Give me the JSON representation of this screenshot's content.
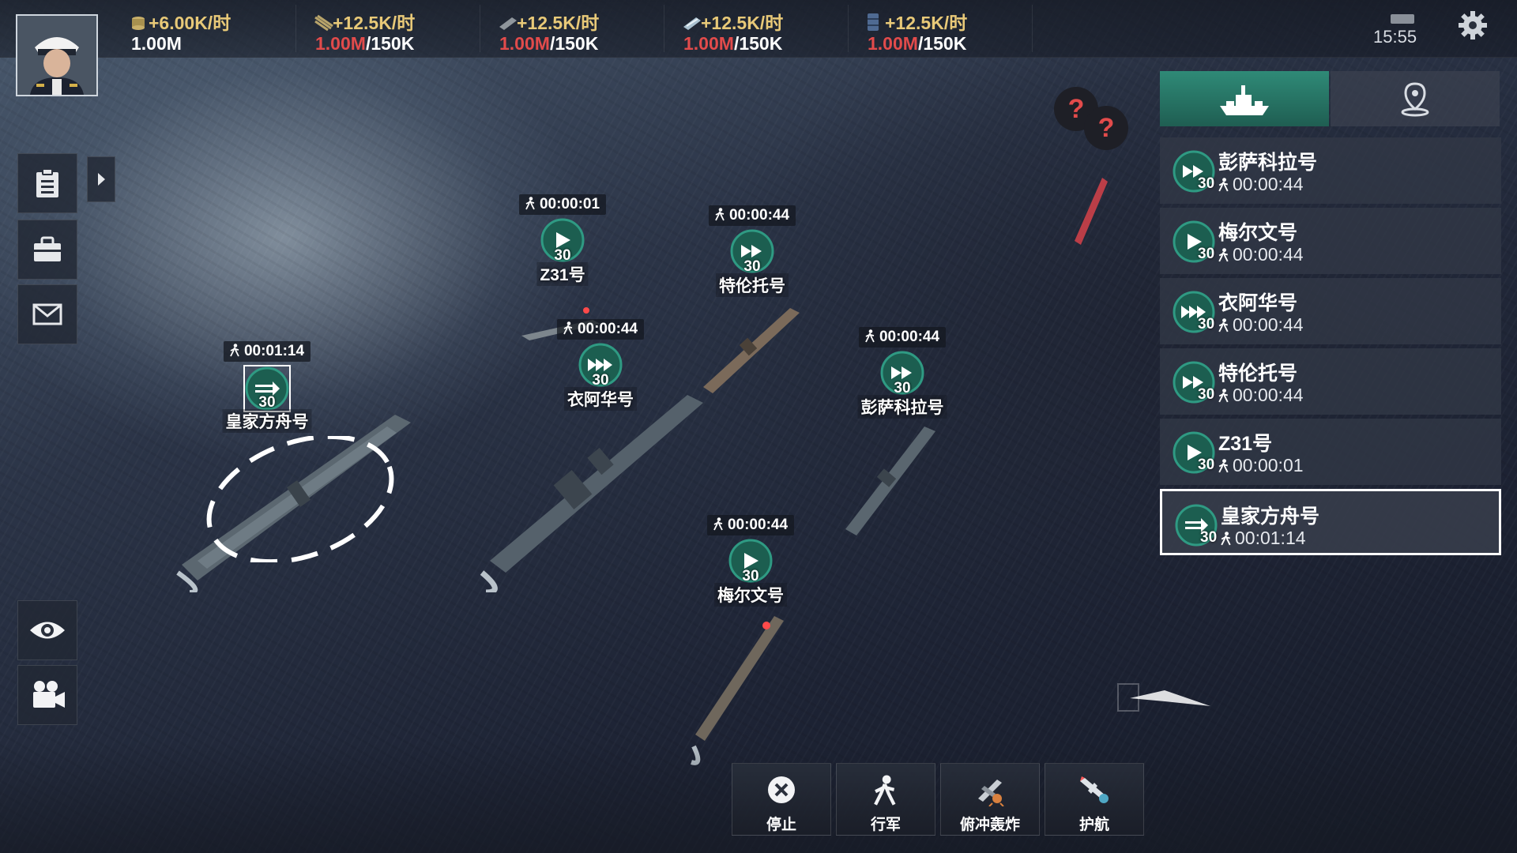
{
  "resources": [
    {
      "icon": "coin-stack-icon",
      "rate": "+6.00K/时",
      "current": "1.00M",
      "cap": ""
    },
    {
      "icon": "oil-icon",
      "rate": "+12.5K/时",
      "current": "1.00M",
      "cap": "/150K"
    },
    {
      "icon": "steel-icon",
      "rate": "+12.5K/时",
      "current": "1.00M",
      "cap": "/150K"
    },
    {
      "icon": "aluminum-icon",
      "rate": "+12.5K/时",
      "current": "1.00M",
      "cap": "/150K"
    },
    {
      "icon": "fuel-barrel-icon",
      "rate": "+12.5K/时",
      "current": "1.00M",
      "cap": "/150K"
    }
  ],
  "status": {
    "clock": "15:55"
  },
  "map_markers": [
    {
      "name": "Z31号",
      "timer": "00:00:01",
      "level": "30"
    },
    {
      "name": "特伦托号",
      "timer": "00:00:44",
      "level": "30"
    },
    {
      "name": "衣阿华号",
      "timer": "00:00:44",
      "level": "30"
    },
    {
      "name": "彭萨科拉号",
      "timer": "00:00:44",
      "level": "30"
    },
    {
      "name": "皇家方舟号",
      "timer": "00:01:14",
      "level": "30"
    },
    {
      "name": "梅尔文号",
      "timer": "00:00:44",
      "level": "30"
    }
  ],
  "fleet_list": [
    {
      "name": "彭萨科拉号",
      "time": "00:00:44",
      "level": "30",
      "selected": false
    },
    {
      "name": "梅尔文号",
      "time": "00:00:44",
      "level": "30",
      "selected": false
    },
    {
      "name": "衣阿华号",
      "time": "00:00:44",
      "level": "30",
      "selected": false
    },
    {
      "name": "特伦托号",
      "time": "00:00:44",
      "level": "30",
      "selected": false
    },
    {
      "name": "Z31号",
      "time": "00:00:01",
      "level": "30",
      "selected": false
    },
    {
      "name": "皇家方舟号",
      "time": "00:01:14",
      "level": "30",
      "selected": true
    }
  ],
  "actions": [
    {
      "label": "停止",
      "icon": "stop-x-icon"
    },
    {
      "label": "行军",
      "icon": "walk-icon"
    },
    {
      "label": "俯冲轰炸",
      "icon": "dive-bomb-icon"
    },
    {
      "label": "护航",
      "icon": "escort-plane-icon"
    }
  ],
  "unknown_markers": [
    "?",
    "?"
  ],
  "colors": {
    "accent_green": "#2f8a77",
    "capacity_red": "#e24b4b",
    "rate_gold": "#e8c978"
  }
}
